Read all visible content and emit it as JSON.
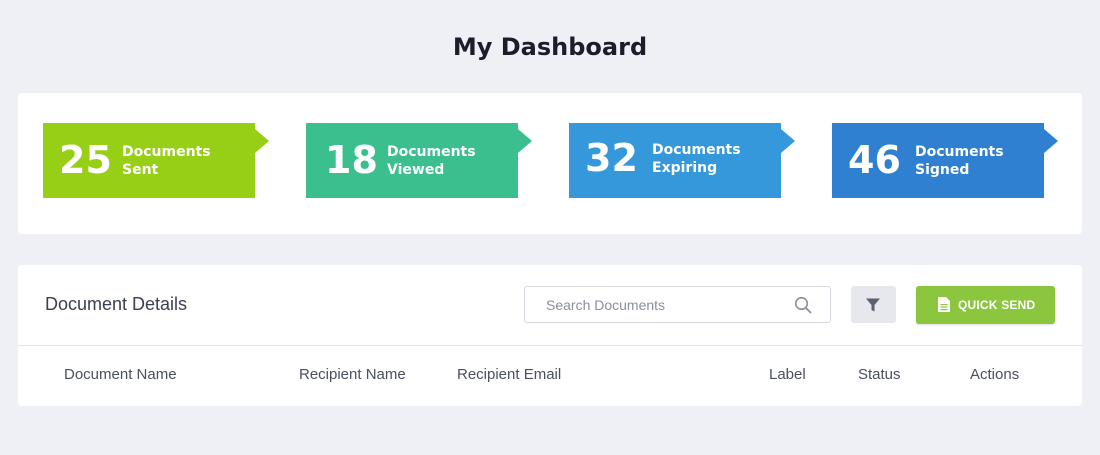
{
  "page": {
    "title": "My Dashboard"
  },
  "stats": [
    {
      "count": "25",
      "line1": "Documents",
      "line2": "Sent",
      "color": "#97cf17"
    },
    {
      "count": "18",
      "line1": "Documents",
      "line2": "Viewed",
      "color": "#3cbf8e"
    },
    {
      "count": "32",
      "line1": "Documents",
      "line2": "Expiring",
      "color": "#3498db"
    },
    {
      "count": "46",
      "line1": "Documents",
      "line2": "Signed",
      "color": "#2f80d0"
    }
  ],
  "details": {
    "title": "Document Details",
    "search": {
      "placeholder": "Search Documents",
      "value": "",
      "icon": "search-icon"
    },
    "filter": {
      "icon": "filter-icon"
    },
    "quick_send": {
      "label": "QUICK SEND",
      "icon": "document-icon",
      "color": "#8cc63f"
    },
    "columns": [
      "Document Name",
      "Recipient Name",
      "Recipient Email",
      "Label",
      "Status",
      "Actions"
    ]
  }
}
